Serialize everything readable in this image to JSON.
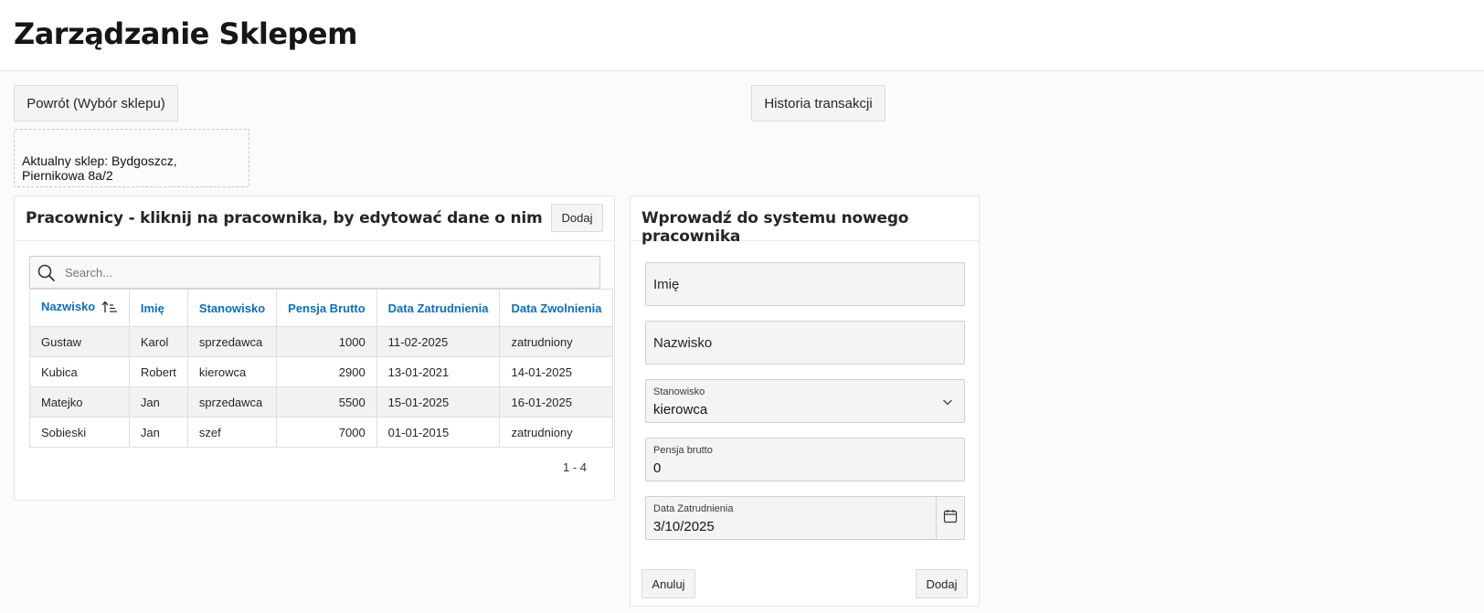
{
  "header": {
    "title": "Zarządzanie Sklepem"
  },
  "nav": {
    "back_label": "Powrót (Wybór sklepu)",
    "history_label": "Historia transakcji"
  },
  "store": {
    "line1": "Aktualny sklep: Bydgoszcz,",
    "line2": "Piernikowa 8a/2"
  },
  "employees": {
    "title": "Pracownicy - kliknij na pracownika, by edytować dane o nim",
    "add_label": "Dodaj",
    "search_placeholder": "Search...",
    "columns": [
      "Nazwisko",
      "Imię",
      "Stanowisko",
      "Pensja Brutto",
      "Data Zatrudnienia",
      "Data Zwolnienia"
    ],
    "sort_column": "Nazwisko",
    "sort_direction": "ascending",
    "rows": [
      [
        "Gustaw",
        "Karol",
        "sprzedawca",
        "1000",
        "11-02-2025",
        "zatrudniony"
      ],
      [
        "Kubica",
        "Robert",
        "kierowca",
        "2900",
        "13-01-2021",
        "14-01-2025"
      ],
      [
        "Matejko",
        "Jan",
        "sprzedawca",
        "5500",
        "15-01-2025",
        "16-01-2025"
      ],
      [
        "Sobieski",
        "Jan",
        "szef",
        "7000",
        "01-01-2015",
        "zatrudniony"
      ]
    ],
    "pagination": "1 - 4"
  },
  "new_employee": {
    "title": "Wprowadź do systemu nowego pracownika",
    "first_name_placeholder": "Imię",
    "last_name_placeholder": "Nazwisko",
    "position_label": "Stanowisko",
    "position_value": "kierowca",
    "salary_label": "Pensja brutto",
    "salary_value": "0",
    "hire_date_label": "Data Zatrudnienia",
    "hire_date_value": "3/10/2025",
    "cancel_label": "Anuluj",
    "submit_label": "Dodaj"
  },
  "colors": {
    "accent": "#0a6fc2",
    "page_background": "#fbfbfb",
    "stripe": "#f2f2f2"
  },
  "icons": {
    "search": "search-icon",
    "sort": "sort-ascending-icon",
    "dropdown": "chevron-down-icon",
    "calendar": "calendar-icon"
  }
}
